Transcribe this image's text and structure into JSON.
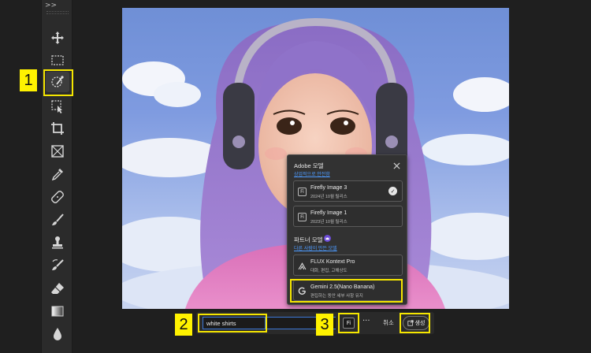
{
  "toolbar": {
    "collapse_label": ">>",
    "tools": [
      {
        "id": "move",
        "icon": "move-icon"
      },
      {
        "id": "marquee",
        "icon": "rect-marquee-icon"
      },
      {
        "id": "object-select",
        "icon": "object-select-icon"
      },
      {
        "id": "quick-select",
        "icon": "quick-select-icon"
      },
      {
        "id": "crop",
        "icon": "crop-icon"
      },
      {
        "id": "frame",
        "icon": "frame-icon"
      },
      {
        "id": "eyedropper",
        "icon": "eyedropper-icon"
      },
      {
        "id": "healing",
        "icon": "healing-brush-icon"
      },
      {
        "id": "brush",
        "icon": "brush-icon"
      },
      {
        "id": "stamp",
        "icon": "clone-stamp-icon"
      },
      {
        "id": "history-brush",
        "icon": "history-brush-icon"
      },
      {
        "id": "eraser",
        "icon": "eraser-icon"
      },
      {
        "id": "gradient",
        "icon": "gradient-icon"
      },
      {
        "id": "blur",
        "icon": "blur-drop-icon"
      }
    ]
  },
  "callouts": {
    "one": "1",
    "two": "2",
    "three": "3"
  },
  "model_panel": {
    "adobe_heading": "Adobe 모델",
    "adobe_link": "상업적으로 안전함",
    "adobe_models": [
      {
        "name": "Firefly Image 3",
        "subtitle": "2024년 10월 릴리스",
        "icon": "firefly-icon",
        "selected": true
      },
      {
        "name": "Firefly Image 1",
        "subtitle": "2023년 10월 릴리스",
        "icon": "firefly-icon",
        "selected": false
      }
    ],
    "partner_heading": "파트너 모델",
    "partner_link": "다른 사람이 만든 모델",
    "partner_models": [
      {
        "name": "FLUX Kontext Pro",
        "subtitle": "대화, 편집, 고해상도",
        "icon": "flux-icon"
      },
      {
        "name": "Gemini 2.5(Nano Banana)",
        "subtitle": "편집하는 동안 세부 사항 유지",
        "icon": "google-g-icon"
      }
    ]
  },
  "bottom_bar": {
    "prompt_value": "white shirts",
    "model_button_label": "Fi",
    "more_label": "···",
    "cancel_label": "취소",
    "generate_label": "생성"
  },
  "colors": {
    "accent_blue": "#3d78d8",
    "callout_yellow": "#fff200",
    "link_blue": "#4d9bff"
  }
}
